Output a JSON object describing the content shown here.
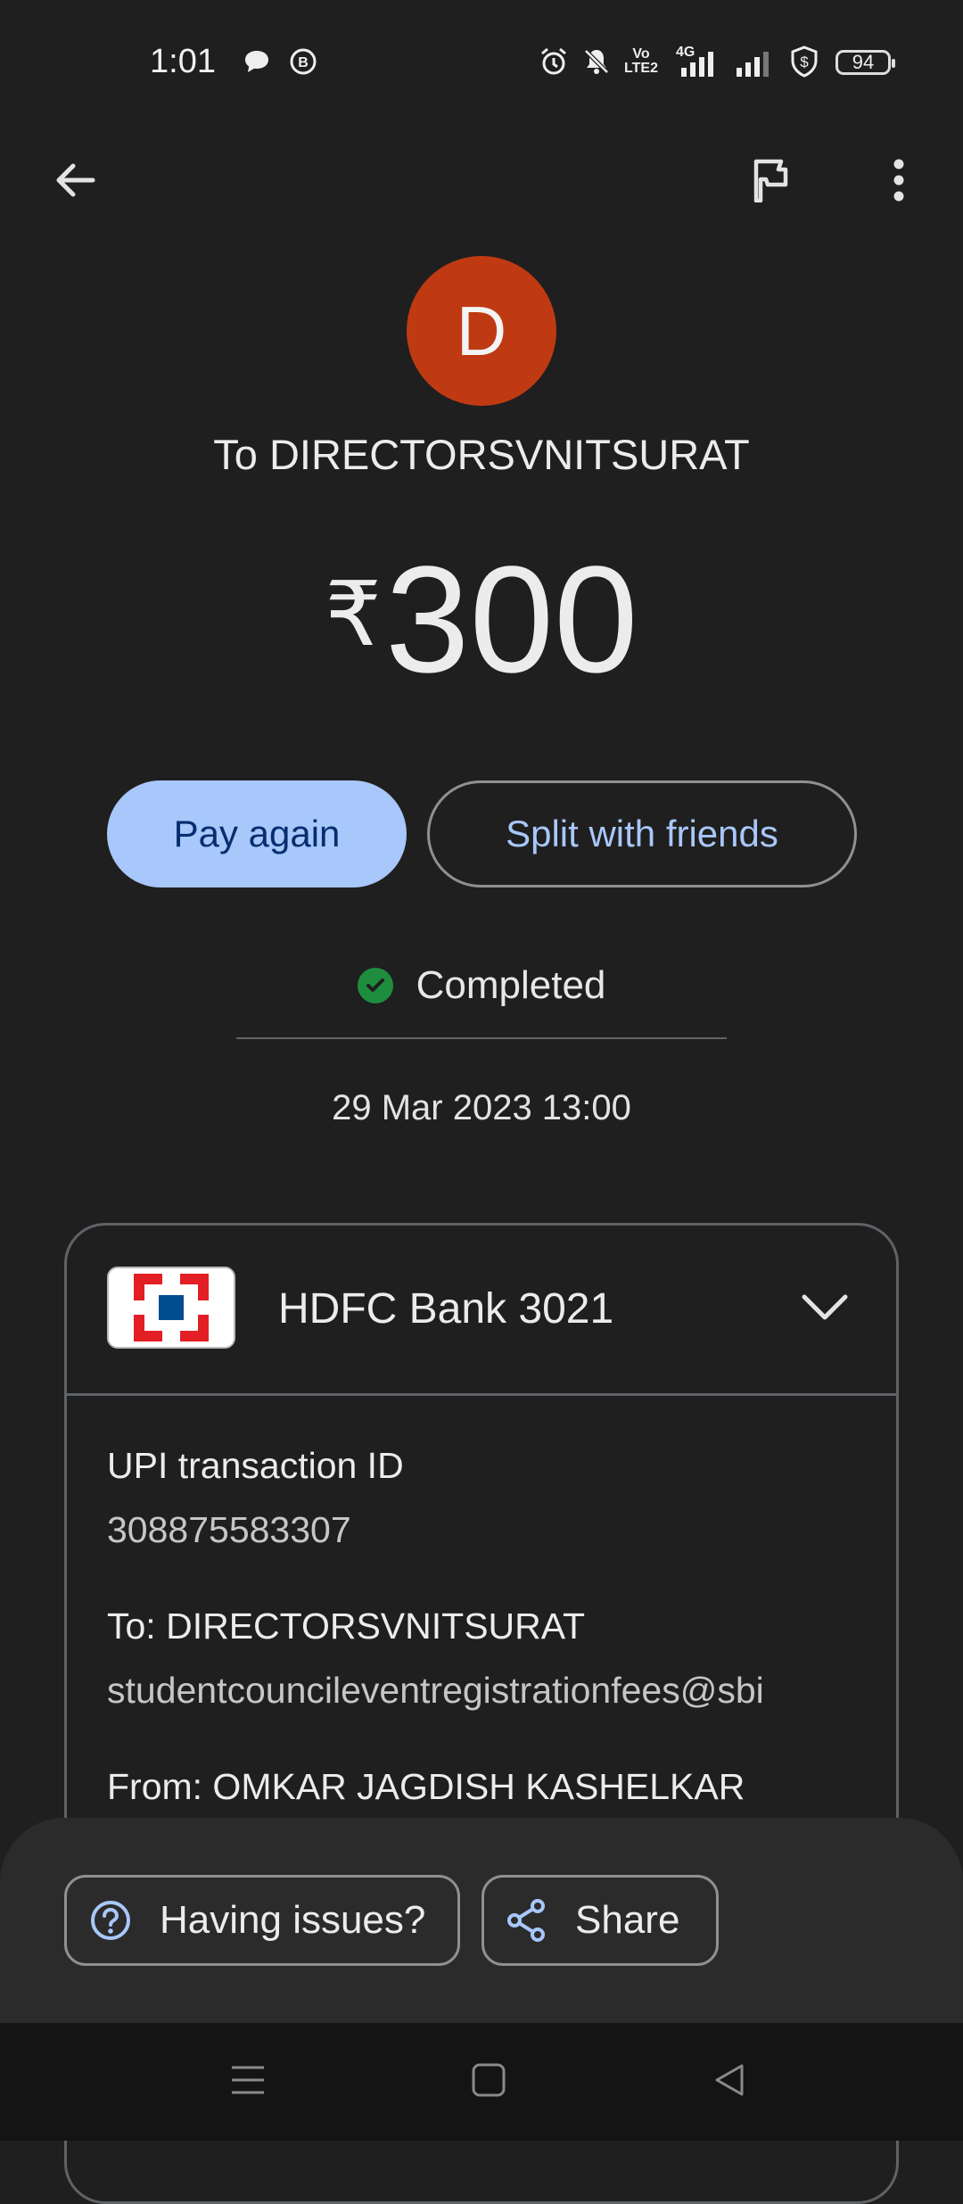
{
  "status_bar": {
    "time": "1:01",
    "volte_label": "Vo LTE2",
    "network_label": "4G",
    "battery": "94"
  },
  "app_bar": {
    "back_icon": "arrow-back-icon",
    "report_icon": "flag-icon",
    "more_icon": "more-vertical-icon"
  },
  "payee": {
    "avatar_letter": "D",
    "avatar_color": "#bf3a12",
    "title": "To DIRECTORSVNITSURAT"
  },
  "amount": {
    "currency": "₹",
    "value": "300"
  },
  "actions": {
    "pay_again": "Pay again",
    "split": "Split with friends"
  },
  "transaction": {
    "status": "Completed",
    "status_color": "#1e8e3e",
    "date": "29 Mar 2023 13:00"
  },
  "details": {
    "bank": "HDFC Bank 3021",
    "upi_label": "UPI transaction ID",
    "upi_id": "308875583307",
    "to_label": "To: DIRECTORSVNITSURAT",
    "to_vpa": "studentcouncileventregistrationfees@sbi",
    "from_label": "From: OMKAR JAGDISH KASHELKAR"
  },
  "bottom_actions": {
    "issues": "Having issues?",
    "share": "Share"
  }
}
